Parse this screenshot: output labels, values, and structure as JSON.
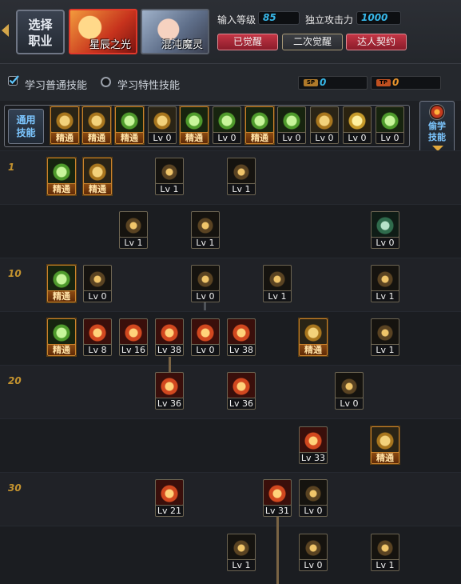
{
  "header": {
    "select_job_label": "选择\n职业",
    "portraits": [
      {
        "label": "星辰之光",
        "active": true
      },
      {
        "label": "混沌魔灵",
        "active": false
      }
    ],
    "level_label": "输入等级",
    "level_value": "85",
    "attack_label": "独立攻击力",
    "attack_value": "1000",
    "awaken_buttons": [
      {
        "label": "已觉醒",
        "style": "red"
      },
      {
        "label": "二次觉醒",
        "style": "gray"
      },
      {
        "label": "达人契约",
        "style": "red"
      }
    ]
  },
  "learn": {
    "normal_label": "学习普通技能",
    "special_label": "学习特性技能",
    "sp_tag": "SP",
    "sp_value": "0",
    "tp_tag": "TP",
    "tp_value": "0"
  },
  "common": {
    "label": "通用\n技能",
    "steal_label": "偷学\n技能",
    "skills": [
      {
        "icon": "running-figure-icon",
        "tone": "t-gold",
        "level": "精通",
        "master": true
      },
      {
        "icon": "kneeling-figure-icon",
        "tone": "t-gold",
        "level": "精通",
        "master": true
      },
      {
        "icon": "dash-figure-icon",
        "tone": "t-green",
        "level": "精通",
        "master": true
      },
      {
        "icon": "wings-icon",
        "tone": "t-gold",
        "level": "Lv 0",
        "master": false
      },
      {
        "icon": "target-icon",
        "tone": "t-green",
        "level": "精通",
        "master": true
      },
      {
        "icon": "crosshair-icon",
        "tone": "t-green",
        "level": "Lv 0",
        "master": false
      },
      {
        "icon": "meditate-icon",
        "tone": "t-green",
        "level": "精通",
        "master": true
      },
      {
        "icon": "gears-figure-icon",
        "tone": "t-green",
        "level": "Lv 0",
        "master": false
      },
      {
        "icon": "eye-rune-icon",
        "tone": "t-gold",
        "level": "Lv 0",
        "master": false
      },
      {
        "icon": "strongman-icon",
        "tone": "t-yellow",
        "level": "Lv 0",
        "master": false
      },
      {
        "icon": "kick-figure-icon",
        "tone": "t-green",
        "level": "Lv 0",
        "master": false
      }
    ]
  },
  "tree": {
    "level_marks": [
      "1",
      "10",
      "20",
      "30"
    ],
    "skills": [
      {
        "icon": "summon-green-icon",
        "tone": "t-green",
        "level": "精通",
        "master": true
      },
      {
        "icon": "swap-arrows-icon",
        "tone": "t-gold",
        "level": "精通",
        "master": true
      },
      {
        "icon": "feather-slash-icon",
        "tone": "t-dark",
        "level": "Lv 1",
        "master": false
      },
      {
        "icon": "fire-hand-icon",
        "tone": "t-dark",
        "level": "Lv 1",
        "master": false
      },
      {
        "icon": "gear-ring-icon",
        "tone": "t-dark",
        "level": "Lv 1",
        "master": false
      },
      {
        "icon": "crest-icon",
        "tone": "t-dark",
        "level": "Lv 1",
        "master": false
      },
      {
        "icon": "green-shield-icon",
        "tone": "t-teal",
        "level": "Lv 0",
        "master": false
      },
      {
        "icon": "sword-pillar-icon",
        "tone": "t-green",
        "level": "精通",
        "master": true
      },
      {
        "icon": "flying-bird-icon",
        "tone": "t-dark",
        "level": "Lv 0",
        "master": false
      },
      {
        "icon": "shield-icon",
        "tone": "t-dark",
        "level": "Lv 0",
        "master": false
      },
      {
        "icon": "arrow-burst-icon",
        "tone": "t-dark",
        "level": "Lv 1",
        "master": false
      },
      {
        "icon": "broken-stone-icon",
        "tone": "t-dark",
        "level": "Lv 1",
        "master": false
      },
      {
        "icon": "green-fighter-icon",
        "tone": "t-green",
        "level": "精通",
        "master": true
      },
      {
        "icon": "red-star-icon",
        "tone": "t-red",
        "level": "Lv 8",
        "master": false
      },
      {
        "icon": "red-slash-icon",
        "tone": "t-red",
        "level": "Lv 16",
        "master": false
      },
      {
        "icon": "fire-burst-icon",
        "tone": "t-red",
        "level": "Lv 38",
        "master": false
      },
      {
        "icon": "red-runner-icon",
        "tone": "t-red",
        "level": "Lv 0",
        "master": false
      },
      {
        "icon": "cross-blades-icon",
        "tone": "t-red",
        "level": "Lv 38",
        "master": false
      },
      {
        "icon": "cross-swords-icon",
        "tone": "t-gold",
        "level": "精通",
        "master": true
      },
      {
        "icon": "flame-swirl-icon",
        "tone": "t-dark",
        "level": "Lv 1",
        "master": false
      },
      {
        "icon": "red-sweep-icon",
        "tone": "t-red",
        "level": "Lv 36",
        "master": false
      },
      {
        "icon": "red-vortex-icon",
        "tone": "t-red",
        "level": "Lv 36",
        "master": false
      },
      {
        "icon": "dark-orb-icon",
        "tone": "t-dark",
        "level": "Lv 0",
        "master": false
      },
      {
        "icon": "red-shield-icon",
        "tone": "t-red",
        "level": "Lv 33",
        "master": false
      },
      {
        "icon": "golden-armor-icon",
        "tone": "t-gold",
        "level": "精通",
        "master": true
      },
      {
        "icon": "red-banner-icon",
        "tone": "t-red",
        "level": "Lv 21",
        "master": false
      },
      {
        "icon": "red-lance-icon",
        "tone": "t-red",
        "level": "Lv 31",
        "master": false
      },
      {
        "icon": "golden-wing-icon",
        "tone": "t-dark",
        "level": "Lv 0",
        "master": false
      },
      {
        "icon": "knight-shield-icon",
        "tone": "t-dark",
        "level": "Lv 1",
        "master": false
      },
      {
        "icon": "star-blast-icon",
        "tone": "t-dark",
        "level": "Lv 0",
        "master": false
      },
      {
        "icon": "dragon-icon",
        "tone": "t-dark",
        "level": "Lv 1",
        "master": false
      }
    ]
  }
}
